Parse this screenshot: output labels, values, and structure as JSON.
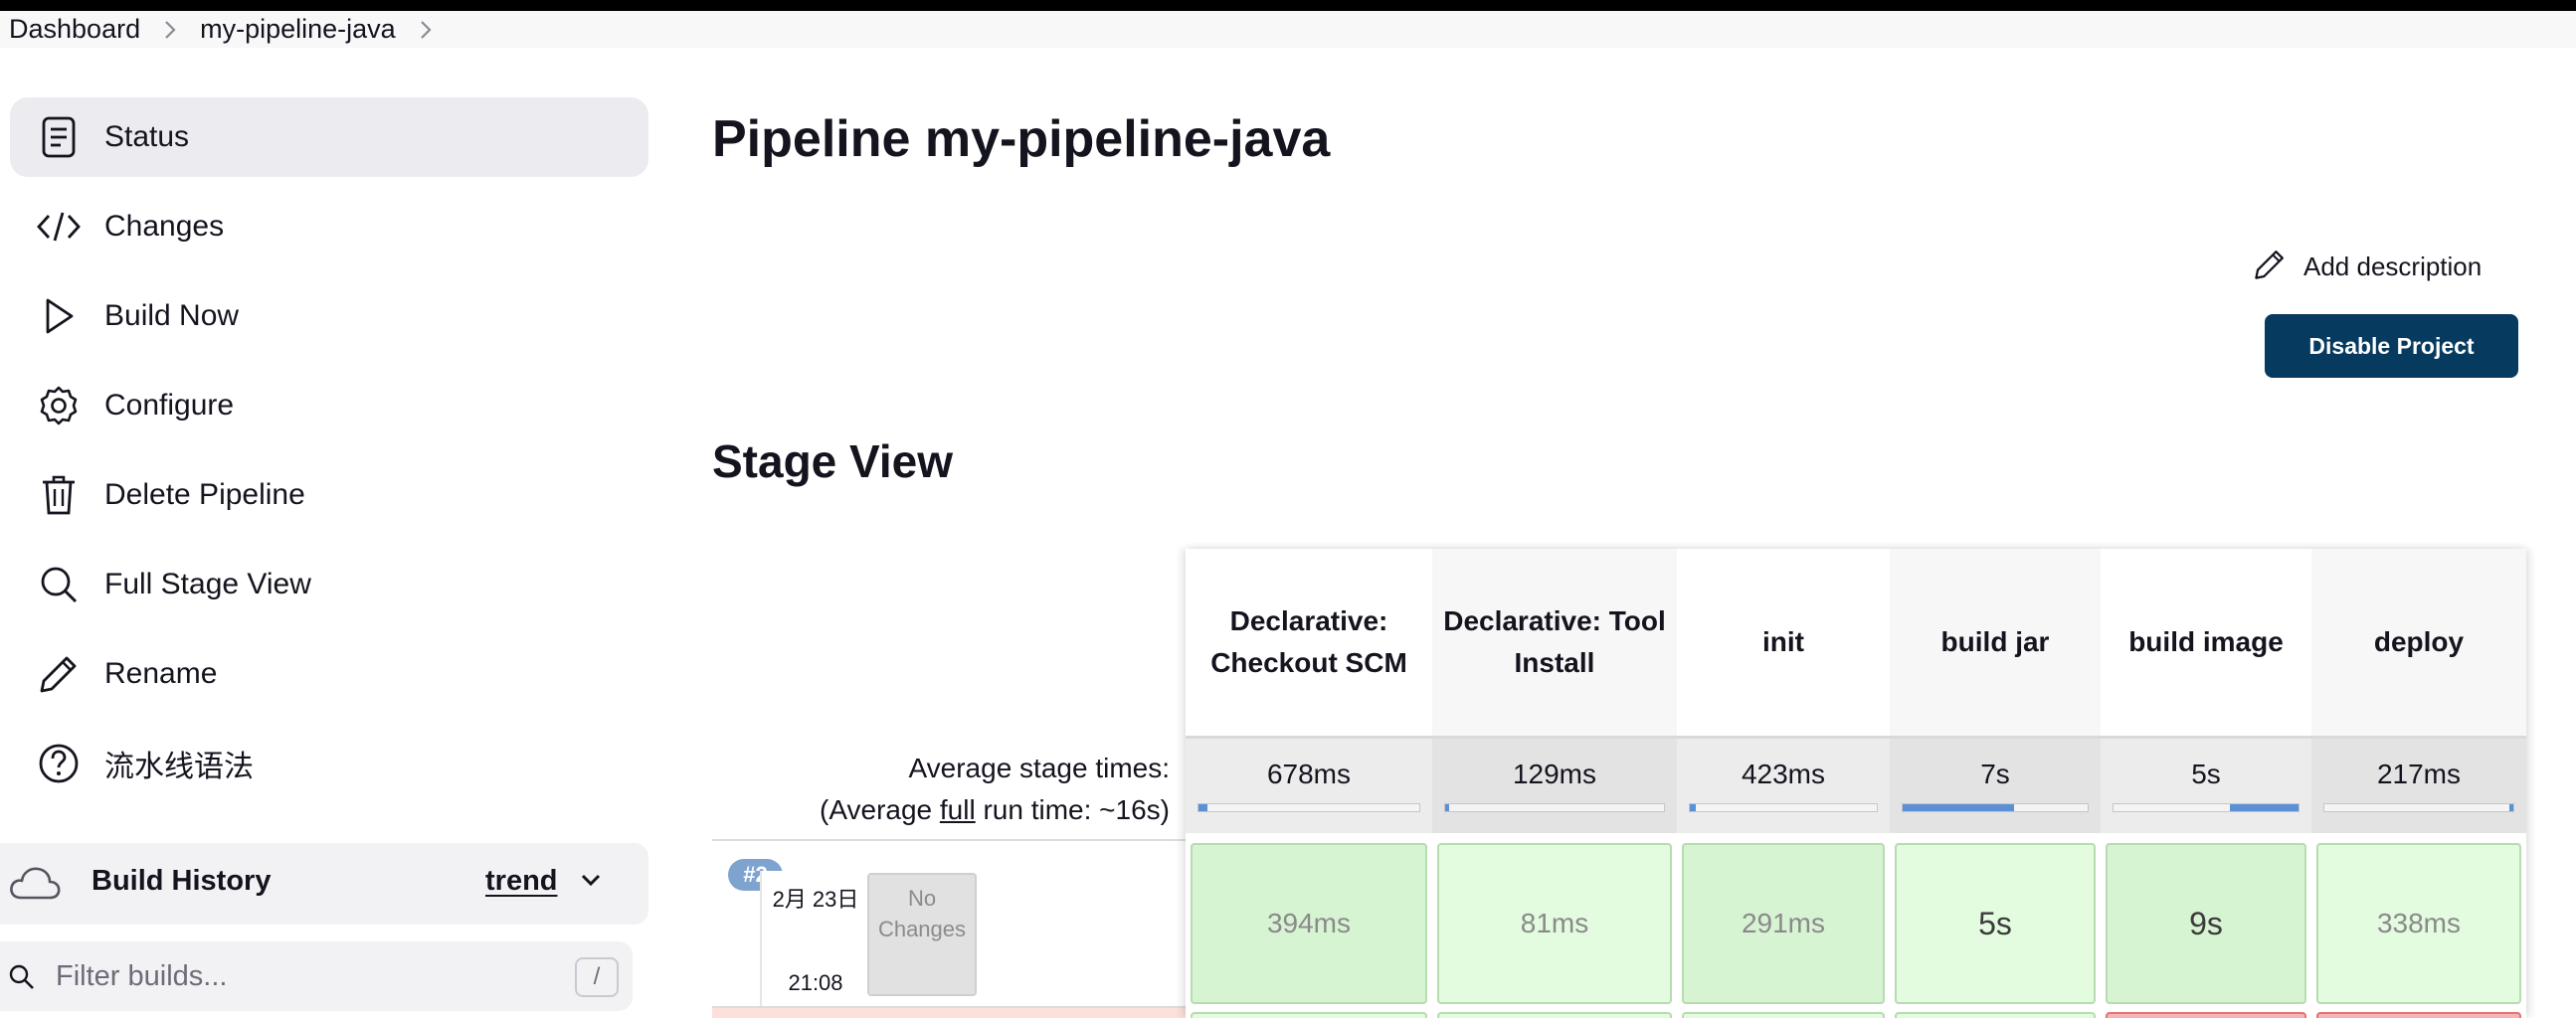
{
  "breadcrumb": {
    "items": [
      "Dashboard",
      "my-pipeline-java"
    ]
  },
  "sidebar": {
    "items": [
      {
        "label": "Status",
        "icon": "document-icon",
        "active": true
      },
      {
        "label": "Changes",
        "icon": "code-icon"
      },
      {
        "label": "Build Now",
        "icon": "play-icon"
      },
      {
        "label": "Configure",
        "icon": "gear-icon"
      },
      {
        "label": "Delete Pipeline",
        "icon": "trash-icon"
      },
      {
        "label": "Full Stage View",
        "icon": "search-icon"
      },
      {
        "label": "Rename",
        "icon": "pencil-icon"
      },
      {
        "label": "流水线语法",
        "icon": "help-icon"
      }
    ]
  },
  "build_history": {
    "title": "Build History",
    "trend_label": "trend"
  },
  "filter": {
    "placeholder": "Filter builds...",
    "shortcut": "/"
  },
  "main": {
    "title": "Pipeline my-pipeline-java",
    "add_description": "Add description",
    "disable_project": "Disable Project",
    "stage_view_title": "Stage View"
  },
  "stage_view": {
    "avg_label_line1": "Average stage times:",
    "avg_label_line2_prefix": "(Average ",
    "avg_label_full": "full",
    "avg_label_line2_suffix": " run time: ~16s)",
    "stages": [
      {
        "name": "Declarative: Checkout SCM",
        "avg": "678ms",
        "progress": 0.04
      },
      {
        "name": "Declarative: Tool Install",
        "avg": "129ms",
        "progress": 0.02
      },
      {
        "name": "init",
        "avg": "423ms",
        "progress": 0.03
      },
      {
        "name": "build jar",
        "avg": "7s",
        "progress": 0.6
      },
      {
        "name": "build image",
        "avg": "5s",
        "progress": 0.37
      },
      {
        "name": "deploy",
        "avg": "217ms",
        "progress": 0.02
      }
    ],
    "run": {
      "badge": "#2",
      "date": "2月 23日",
      "time": "21:08",
      "changes": "No Changes",
      "results": [
        "394ms",
        "81ms",
        "291ms",
        "5s",
        "9s",
        "338ms"
      ]
    },
    "colors": {
      "success": "#e3fbdf",
      "failure": "#f6b4b4",
      "progress_bar": "#5b8fd6"
    }
  }
}
